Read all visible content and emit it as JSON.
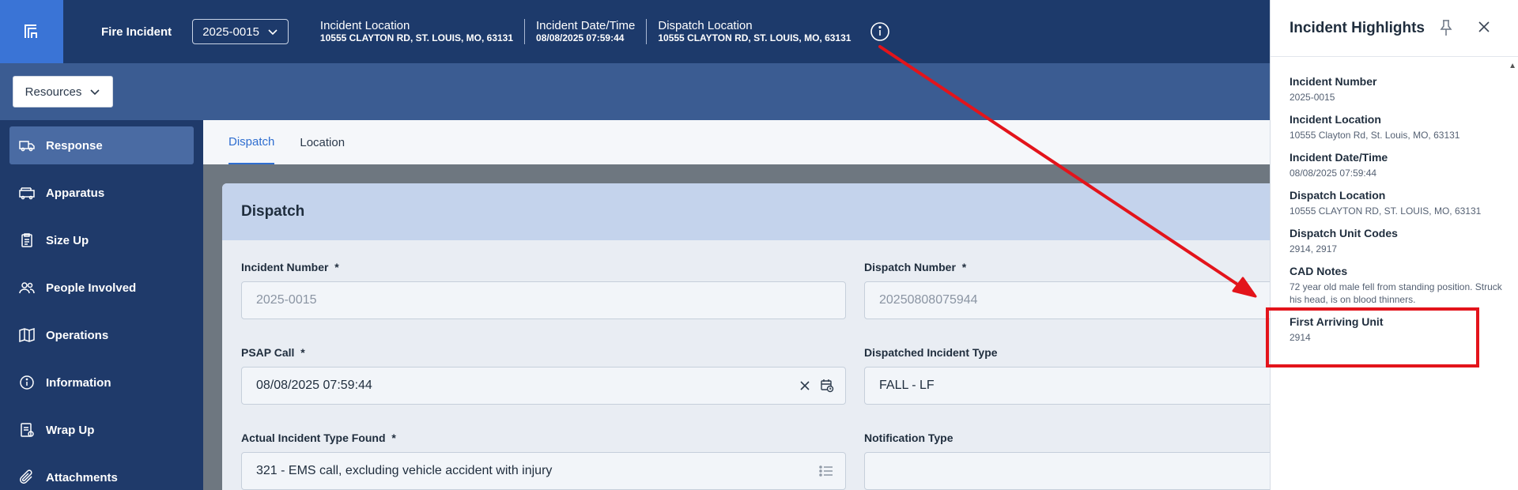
{
  "topbar": {
    "app_name": "Fire Incident",
    "incident_select": "2025-0015",
    "incident_location_label": "Incident Location",
    "incident_location_value": "10555 CLAYTON RD, ST. LOUIS, MO, 63131",
    "incident_datetime_label": "Incident Date/Time",
    "incident_datetime_value": "08/08/2025 07:59:44",
    "dispatch_location_label": "Dispatch Location",
    "dispatch_location_value": "10555 CLAYTON RD, ST. LOUIS, MO, 63131"
  },
  "resources": {
    "label": "Resources"
  },
  "sidebar": {
    "items": [
      {
        "label": "Response",
        "icon": "truck-icon"
      },
      {
        "label": "Apparatus",
        "icon": "fire-truck-icon"
      },
      {
        "label": "Size Up",
        "icon": "clipboard-icon"
      },
      {
        "label": "People Involved",
        "icon": "people-icon"
      },
      {
        "label": "Operations",
        "icon": "map-icon"
      },
      {
        "label": "Information",
        "icon": "info-icon"
      },
      {
        "label": "Wrap Up",
        "icon": "wrap-icon"
      },
      {
        "label": "Attachments",
        "icon": "paperclip-icon"
      }
    ]
  },
  "tabs": [
    {
      "label": "Dispatch"
    },
    {
      "label": "Location"
    }
  ],
  "card": {
    "title": "Dispatch",
    "incident_number_label": "Incident Number",
    "incident_number_value": "2025-0015",
    "dispatch_number_label": "Dispatch Number",
    "dispatch_number_value": "20250808075944",
    "psap_label": "PSAP Call",
    "psap_value": "08/08/2025 07:59:44",
    "dispatched_type_label": "Dispatched Incident Type",
    "dispatched_type_value": "FALL - LF",
    "actual_type_label": "Actual Incident Type Found",
    "actual_type_value": "321 - EMS call, excluding vehicle accident with injury",
    "notification_label": "Notification Type",
    "notification_value": "",
    "required_mark": "*"
  },
  "panel": {
    "title": "Incident Highlights",
    "items": [
      {
        "label": "Incident Number",
        "value": "2025-0015"
      },
      {
        "label": "Incident Location",
        "value": "10555 Clayton Rd, St. Louis, MO, 63131"
      },
      {
        "label": "Incident Date/Time",
        "value": "08/08/2025 07:59:44"
      },
      {
        "label": "Dispatch Location",
        "value": "10555 CLAYTON RD, ST. LOUIS, MO, 63131"
      },
      {
        "label": "Dispatch Unit Codes",
        "value": "2914, 2917"
      },
      {
        "label": "CAD Notes",
        "value": "72 year old male fell from standing position. Struck his head, is on blood thinners."
      },
      {
        "label": "First Arriving Unit",
        "value": "2914"
      }
    ]
  },
  "colors": {
    "topbar": "#1d3a6b",
    "sidebar": "#1f3a6a",
    "accent": "#2f6ed0",
    "annotation": "#e3141b"
  }
}
